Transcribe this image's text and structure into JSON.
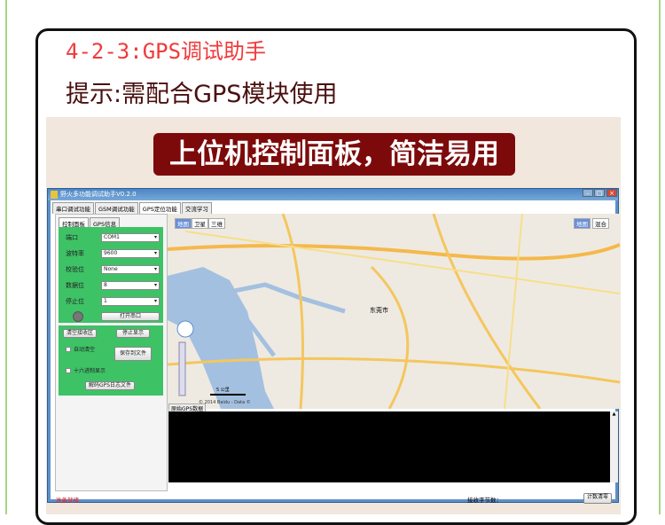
{
  "heading": "4-2-3:GPS调试助手",
  "hint": "提示:需配合GPS模块使用",
  "banner": "上位机控制面板，简洁易用",
  "window": {
    "title": "野火多功能调试助手V0.2.0",
    "tabs": [
      "串口调试功能",
      "GSM调试功能",
      "GPS定位功能",
      "交流学习"
    ],
    "active_tab": "GPS定位功能",
    "sub_tabs": [
      "控制面板",
      "GPS信息"
    ],
    "settings": [
      {
        "label": "端口",
        "value": "COM1"
      },
      {
        "label": "波特率",
        "value": "9600"
      },
      {
        "label": "校验位",
        "value": "None"
      },
      {
        "label": "数据位",
        "value": "8"
      },
      {
        "label": "停止位",
        "value": "1"
      }
    ],
    "open_port": "打开串口",
    "clear_recv": "清空接收区",
    "stop_display": "停止显示",
    "auto_clear": "自动清空",
    "save_file": "保存到文件",
    "hex_display": "十六进制显示",
    "decode_log": "解码GPS日志文件",
    "map": {
      "types_left": [
        "地图",
        "卫星",
        "三维"
      ],
      "types_right": [
        "地图",
        "混合"
      ],
      "scale": "5 公里",
      "copyright": "© 2014 Baidu - Data ©",
      "city": "东莞市"
    },
    "raw_tab": "原始GPS数据",
    "status": "准备就绪",
    "bytes_label": "接收字节数：",
    "reset_count": "计数清零"
  }
}
